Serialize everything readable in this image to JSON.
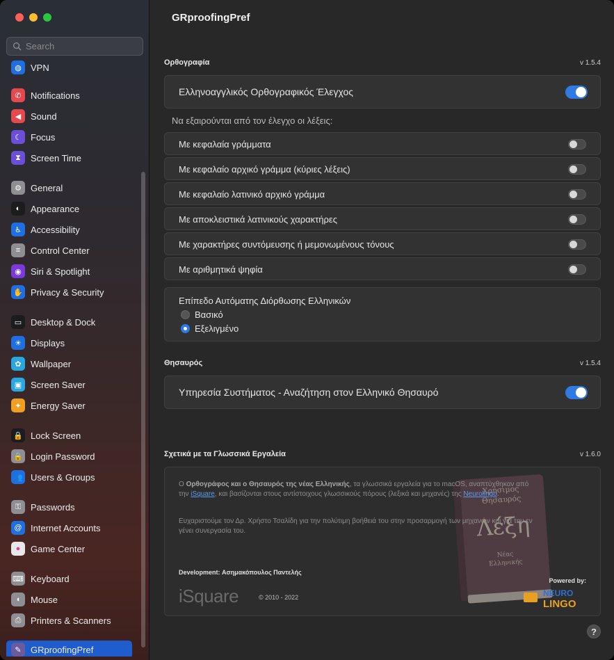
{
  "window": {
    "title": "GRproofingPref"
  },
  "search": {
    "placeholder": "Search"
  },
  "sidebar": {
    "items": [
      {
        "label": "VPN",
        "icon": "globe-icon",
        "color": "#1f6fe0"
      },
      {
        "label": "Notifications",
        "icon": "bell-icon",
        "color": "#e5484d"
      },
      {
        "label": "Sound",
        "icon": "speaker-icon",
        "color": "#e5484d"
      },
      {
        "label": "Focus",
        "icon": "moon-icon",
        "color": "#6b4fd8"
      },
      {
        "label": "Screen Time",
        "icon": "hourglass-icon",
        "color": "#6b4fd8"
      },
      {
        "label": "General",
        "icon": "gear-icon",
        "color": "#8e8e93"
      },
      {
        "label": "Appearance",
        "icon": "appearance-icon",
        "color": "#1c1c1e"
      },
      {
        "label": "Accessibility",
        "icon": "accessibility-icon",
        "color": "#1f6fe0"
      },
      {
        "label": "Control Center",
        "icon": "control-center-icon",
        "color": "#8e8e93"
      },
      {
        "label": "Siri & Spotlight",
        "icon": "siri-icon",
        "color": "#7a3ad8"
      },
      {
        "label": "Privacy & Security",
        "icon": "hand-icon",
        "color": "#1f6fe0"
      },
      {
        "label": "Desktop & Dock",
        "icon": "dock-icon",
        "color": "#1c1c1e"
      },
      {
        "label": "Displays",
        "icon": "sun-icon",
        "color": "#1f6fe0"
      },
      {
        "label": "Wallpaper",
        "icon": "flower-icon",
        "color": "#2aa7e0"
      },
      {
        "label": "Screen Saver",
        "icon": "screen-saver-icon",
        "color": "#2aa7e0"
      },
      {
        "label": "Energy Saver",
        "icon": "bulb-icon",
        "color": "#f0a020"
      },
      {
        "label": "Lock Screen",
        "icon": "lock-icon",
        "color": "#1c1c1e"
      },
      {
        "label": "Login Password",
        "icon": "lock-icon",
        "color": "#8e8e93"
      },
      {
        "label": "Users & Groups",
        "icon": "users-icon",
        "color": "#1f6fe0"
      },
      {
        "label": "Passwords",
        "icon": "key-icon",
        "color": "#8e8e93"
      },
      {
        "label": "Internet Accounts",
        "icon": "at-icon",
        "color": "#1f6fe0"
      },
      {
        "label": "Game Center",
        "icon": "game-center-icon",
        "color": "#e8e8e8"
      },
      {
        "label": "Keyboard",
        "icon": "keyboard-icon",
        "color": "#8e8e93"
      },
      {
        "label": "Mouse",
        "icon": "mouse-icon",
        "color": "#8e8e93"
      },
      {
        "label": "Printers & Scanners",
        "icon": "printer-icon",
        "color": "#8e8e93"
      },
      {
        "label": "GRproofingPref",
        "icon": "grproofing-icon",
        "color": "#6a5aa0",
        "selected": true
      }
    ]
  },
  "spelling": {
    "title": "Ορθογραφία",
    "version": "v 1.5.4",
    "main_toggle": {
      "label": "Ελληνοαγγλικός Ορθογραφικός Έλεγχος",
      "on": true
    },
    "exclude_note": "Να εξαιρούνται από τον έλεγχο οι λέξεις:",
    "options": [
      {
        "label": "Με κεφαλαία γράμματα",
        "on": false
      },
      {
        "label": "Με κεφαλαίο αρχικό γράμμα (κύριες λέξεις)",
        "on": false
      },
      {
        "label": "Με κεφαλαίο λατινικό αρχικό γράμμα",
        "on": false
      },
      {
        "label": "Με αποκλειστικά λατινικούς χαρακτήρες",
        "on": false
      },
      {
        "label": "Με χαρακτήρες συντόμευσης ή μεμονωμένους τόνους",
        "on": false
      },
      {
        "label": "Με αριθμητικά ψηφία",
        "on": false
      }
    ],
    "autocorrect": {
      "title": "Επίπεδο Αυτόματης Διόρθωσης Ελληνικών",
      "choices": [
        {
          "label": "Βασικό",
          "selected": false
        },
        {
          "label": "Εξελιγμένο",
          "selected": true
        }
      ]
    }
  },
  "thesaurus": {
    "title": "Θησαυρός",
    "version": "v 1.5.4",
    "service_toggle": {
      "label": "Υπηρεσία Συστήματος - Αναζήτηση στον Ελληνικό Θησαυρό",
      "on": true
    }
  },
  "about": {
    "title": "Σχετικά με τα Γλωσσικά Εργαλεία",
    "version": "v 1.6.0",
    "p1_a": "Ο ",
    "p1_bold": "Ορθογράφος και ο Θησαυρός της νέας Ελληνικής",
    "p1_b": ", τα γλωσσικά εργαλεία για το macOS, αναπτύχθηκαν από την ",
    "p1_link1": "iSquare",
    "p1_c": ", και βασίζονται στους αντίστοιχους γλωσσικούς πόρους (λεξικά και μηχανές) της ",
    "p1_link2": "Neurolingo",
    "p1_d": ".",
    "p2": "Ευχαριστούμε τον Δρ. Χρήστο Τσαλίδη για την πολύτιμη βοήθειά του στην προσαρμογή των μηχανών και για την εν γένει συνεργασία του.",
    "book": {
      "line1": "Χρήσιμος",
      "line2": "Θησαυρός",
      "big": "Λέξη",
      "line3": "Νέας",
      "line4": "Ελληνικής"
    },
    "development": "Development: Ασημακόπουλος Παντελής",
    "isquare_logo": "iSquare",
    "copyright": "© 2010 - 2022",
    "powered_by": "Powered by:",
    "neuro_logo_top": "NEURO",
    "neuro_logo_bottom": "LINGO"
  },
  "help": {
    "label": "?"
  },
  "colors": {
    "accent": "#2f7ae5",
    "selected_sidebar": "#1f5ccc"
  }
}
